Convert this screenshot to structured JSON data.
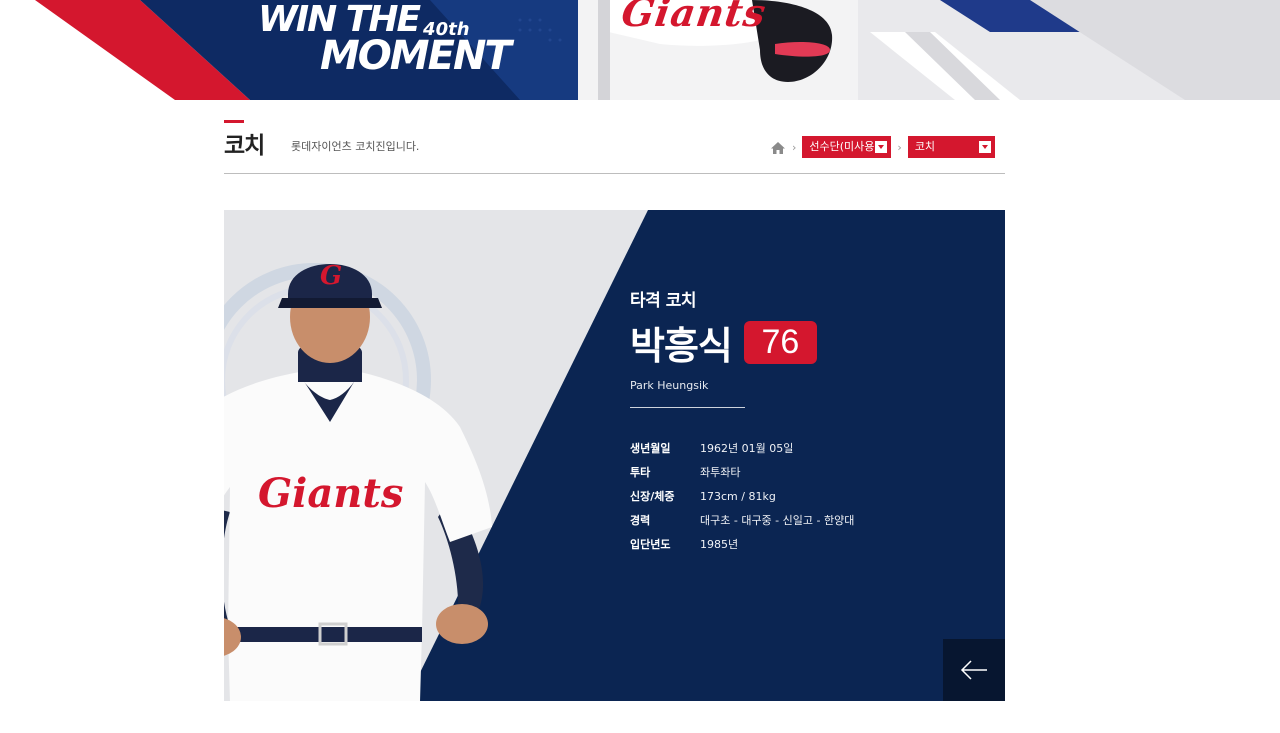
{
  "banner": {
    "line1": "WIN THE",
    "superscript": "40th",
    "line2": "MOMENT",
    "jersey_text": "Giants"
  },
  "header": {
    "title": "코치",
    "description": "롯데자이언츠 코치진입니다."
  },
  "breadcrumb": {
    "home_icon": "home-icon",
    "level1": "선수단(미사용",
    "level2": "코치"
  },
  "profile": {
    "role": "타격 코치",
    "name": "박흥식",
    "number": "76",
    "name_en": "Park Heungsik",
    "jersey_brand": "Giants",
    "stats": [
      {
        "label": "생년월일",
        "value": "1962년 01월 05일"
      },
      {
        "label": "투타",
        "value": "좌투좌타"
      },
      {
        "label": "신장/체중",
        "value": "173cm / 81kg"
      },
      {
        "label": "경력",
        "value": "대구초 - 대구중 - 신일고 - 한양대"
      },
      {
        "label": "입단년도",
        "value": "1985년"
      }
    ],
    "back_icon": "arrow-left-icon"
  },
  "colors": {
    "accent_red": "#d4172e",
    "navy": "#0b2552",
    "dark_navy": "#071630"
  }
}
